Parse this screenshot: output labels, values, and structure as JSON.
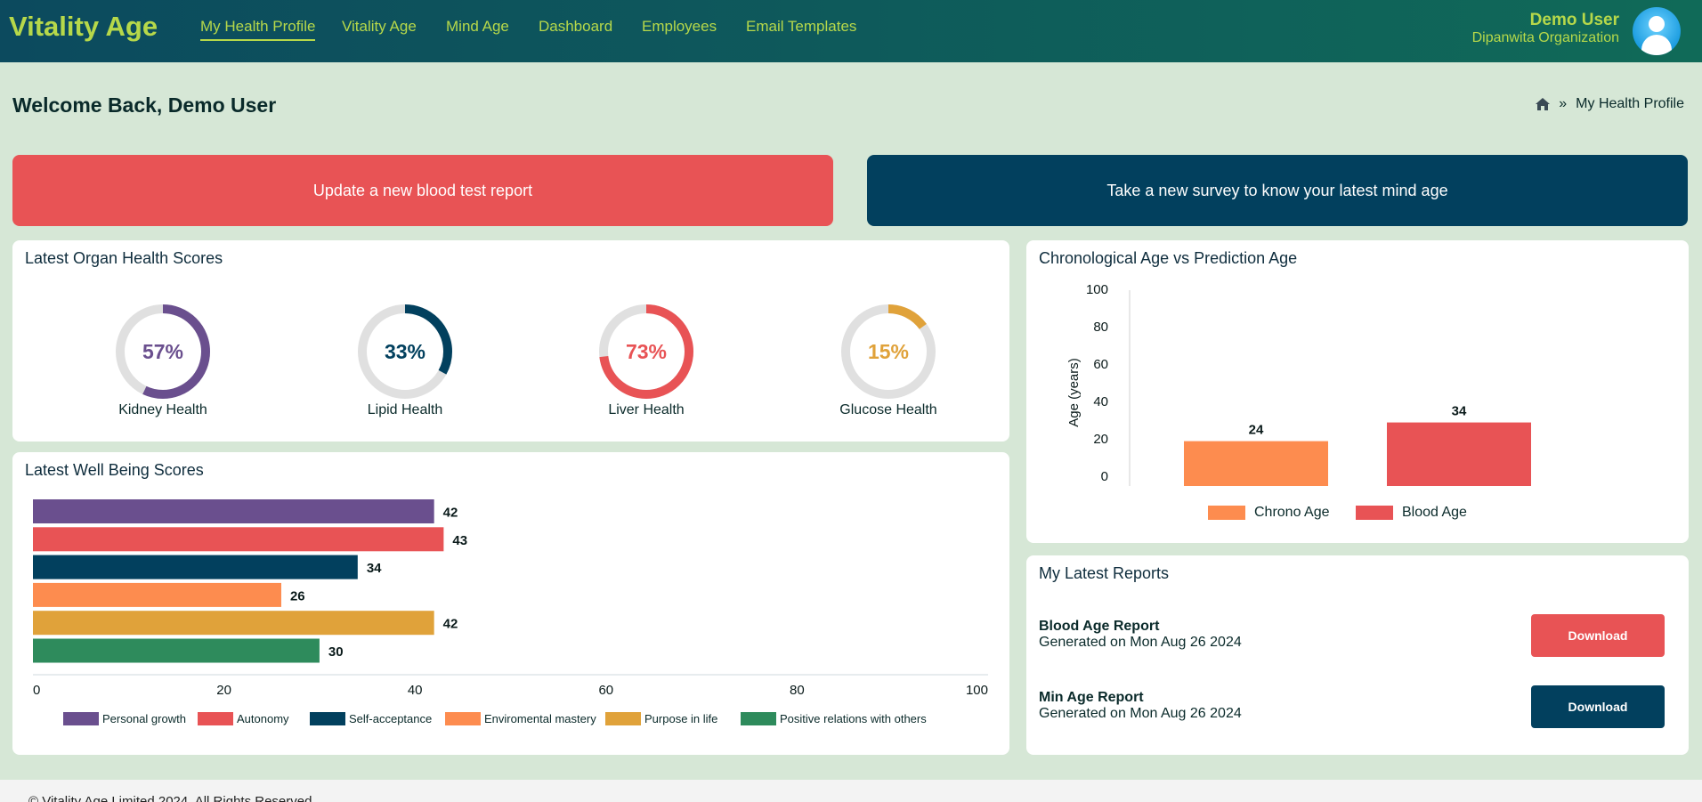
{
  "navbar": {
    "brand": "Vitality Age",
    "links": [
      "My Health Profile",
      "Vitality Age",
      "Mind Age",
      "Dashboard",
      "Employees",
      "Email Templates"
    ],
    "user_name": "Demo User",
    "user_org": "Dipanwita Organization"
  },
  "page": {
    "welcome": "Welcome Back, Demo User",
    "breadcrumb_separator": "»",
    "breadcrumb_current": "My Health Profile"
  },
  "actions": {
    "blood_test": "Update a new blood test report",
    "survey": "Take a new survey to know your latest mind age"
  },
  "organ_scores": {
    "title": "Latest Organ Health Scores",
    "items": [
      {
        "label": "Kidney Health",
        "value": 57,
        "text": "57%",
        "color": "#6a4f8e"
      },
      {
        "label": "Lipid Health",
        "value": 33,
        "text": "33%",
        "color": "#02405e"
      },
      {
        "label": "Liver Health",
        "value": 73,
        "text": "73%",
        "color": "#e85355"
      },
      {
        "label": "Glucose Health",
        "value": 15,
        "text": "15%",
        "color": "#e0a23a"
      }
    ]
  },
  "well_being": {
    "title": "Latest Well Being Scores"
  },
  "age_chart": {
    "title": "Chronological Age vs Prediction Age"
  },
  "reports": {
    "title": "My Latest Reports",
    "items": [
      {
        "name": "Blood Age Report",
        "date": "Generated on Mon Aug 26 2024",
        "button": "Download",
        "color": "#e85355"
      },
      {
        "name": "Min Age Report",
        "date": "Generated on Mon Aug 26 2024",
        "button": "Download",
        "color": "#02405e"
      }
    ]
  },
  "footer": {
    "text": "© Vitality Age Limited 2024. All Rights Reserved."
  },
  "chart_data": [
    {
      "type": "bar",
      "orientation": "horizontal",
      "title": "Latest Well Being Scores",
      "categories": [
        "Personal growth",
        "Autonomy",
        "Self-acceptance",
        "Enviromental mastery",
        "Purpose in life",
        "Positive relations with others"
      ],
      "values": [
        42,
        43,
        34,
        26,
        42,
        30
      ],
      "colors": [
        "#6a4f8e",
        "#e85355",
        "#02405e",
        "#fd8c4f",
        "#e0a23a",
        "#2e8b5c"
      ],
      "xlim": [
        0,
        100
      ],
      "x_ticks": [
        0,
        20,
        40,
        60,
        80,
        100
      ],
      "legend": "bottom",
      "data_labels": true
    },
    {
      "type": "bar",
      "title": "Chronological Age vs Prediction Age",
      "categories": [
        "Chrono Age",
        "Blood Age"
      ],
      "values": [
        24,
        34
      ],
      "colors": [
        "#fd8c4f",
        "#e85355"
      ],
      "ylabel": "Age (years)",
      "ylim": [
        0,
        100
      ],
      "y_ticks": [
        0,
        20,
        40,
        60,
        80,
        100
      ],
      "legend": "bottom",
      "data_labels": true
    }
  ]
}
